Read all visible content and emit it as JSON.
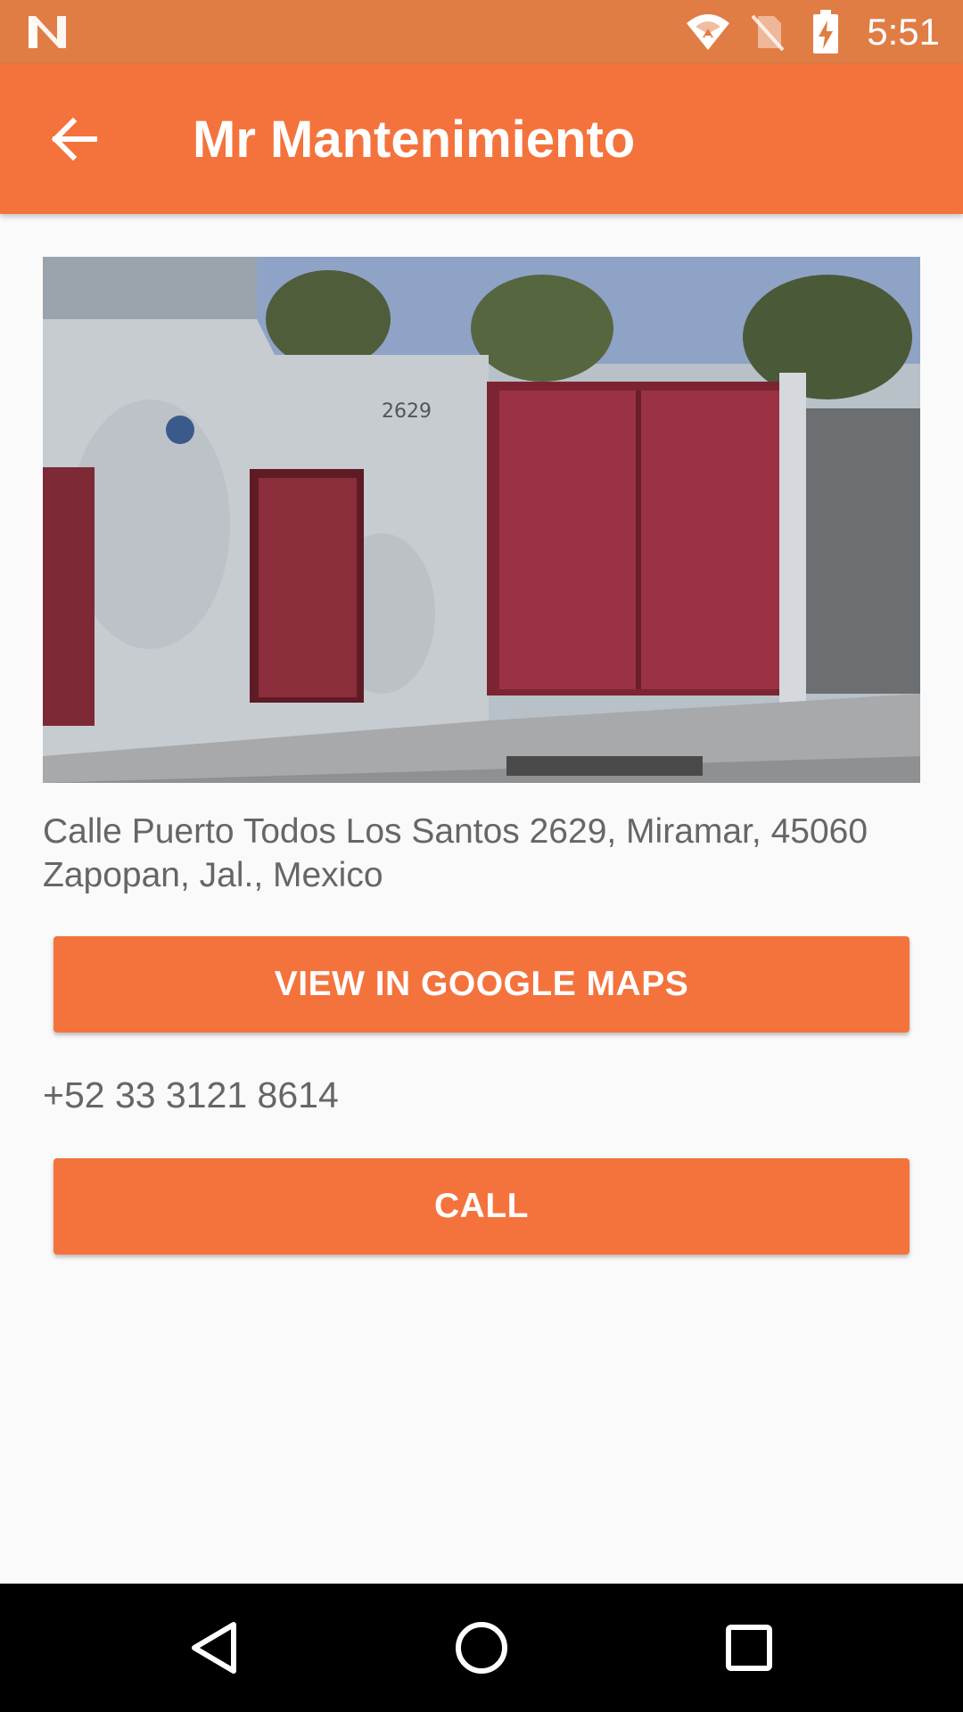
{
  "status_bar": {
    "time": "5:51",
    "icons": [
      "notification-n-icon",
      "wifi-icon",
      "no-sim-icon",
      "battery-charging-icon"
    ]
  },
  "app_bar": {
    "title": "Mr Mantenimiento",
    "back_icon": "arrow-back-icon"
  },
  "place": {
    "photo": "street-view-photo",
    "address": "Calle Puerto Todos Los Santos 2629, Miramar, 45060 Zapopan, Jal., Mexico",
    "phone": "+52 33 3121 8614"
  },
  "buttons": {
    "maps_label": "VIEW IN GOOGLE MAPS",
    "call_label": "CALL"
  },
  "nav_bar": {
    "icons": [
      "nav-back-icon",
      "nav-home-icon",
      "nav-recents-icon"
    ]
  },
  "colors": {
    "primary": "#f4733c",
    "status_bar": "#e07d45",
    "background": "#fafafa",
    "body_text": "#666666"
  }
}
